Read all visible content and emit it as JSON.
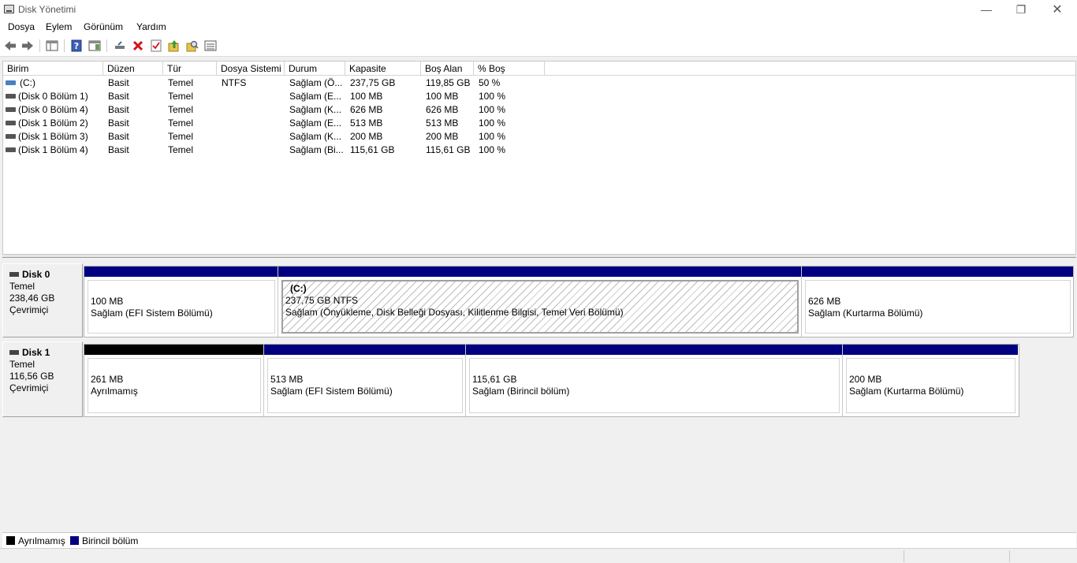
{
  "window": {
    "title": "Disk Yönetimi"
  },
  "menu": [
    "Dosya",
    "Eylem",
    "Görünüm",
    "Yardım"
  ],
  "toolbar": [
    "back-icon",
    "forward-icon",
    "console-tree-icon",
    "help-icon",
    "show-hide-icon",
    "connect-icon",
    "delete-icon",
    "properties-icon",
    "up-arrow-icon",
    "search-icon",
    "list-view-icon"
  ],
  "list": {
    "columns": [
      "Birim",
      "Düzen",
      "Tür",
      "Dosya Sistemi",
      "Durum",
      "Kapasite",
      "Boş Alan",
      "% Boş"
    ],
    "rows": [
      [
        "(C:)",
        "Basit",
        "Temel",
        "NTFS",
        "Sağlam (Ö...",
        "237,75 GB",
        "119,85 GB",
        "50 %"
      ],
      [
        "(Disk 0 Bölüm 1)",
        "Basit",
        "Temel",
        "",
        "Sağlam (E...",
        "100 MB",
        "100 MB",
        "100 %"
      ],
      [
        "(Disk 0 Bölüm 4)",
        "Basit",
        "Temel",
        "",
        "Sağlam (K...",
        "626 MB",
        "626 MB",
        "100 %"
      ],
      [
        "(Disk 1 Bölüm 2)",
        "Basit",
        "Temel",
        "",
        "Sağlam (E...",
        "513 MB",
        "513 MB",
        "100 %"
      ],
      [
        "(Disk 1 Bölüm 3)",
        "Basit",
        "Temel",
        "",
        "Sağlam (K...",
        "200 MB",
        "200 MB",
        "100 %"
      ],
      [
        "(Disk 1 Bölüm 4)",
        "Basit",
        "Temel",
        "",
        "Sağlam (Bi...",
        "115,61 GB",
        "115,61 GB",
        "100 %"
      ]
    ]
  },
  "disks": [
    {
      "name": "Disk 0",
      "type": "Temel",
      "size": "238,46 GB",
      "status": "Çevrimiçi",
      "partitions": [
        {
          "size": "100 MB",
          "status": "Sağlam (EFI Sistem Bölümü)"
        },
        {
          "label": "(C:)",
          "size": "237,75 GB NTFS",
          "status": "Sağlam (Önyükleme, Disk Belleği Dosyası, Kilitlenme Bilgisi, Temel Veri Bölümü)"
        },
        {
          "size": "626 MB",
          "status": "Sağlam (Kurtarma Bölümü)"
        }
      ]
    },
    {
      "name": "Disk 1",
      "type": "Temel",
      "size": "116,56 GB",
      "status": "Çevrimiçi",
      "partitions": [
        {
          "size": "261 MB",
          "status": "Ayrılmamış"
        },
        {
          "size": "513 MB",
          "status": "Sağlam (EFI Sistem Bölümü)"
        },
        {
          "size": "115,61 GB",
          "status": "Sağlam (Birincil bölüm)"
        },
        {
          "size": "200 MB",
          "status": "Sağlam (Kurtarma Bölümü)"
        }
      ]
    }
  ],
  "legend": [
    {
      "label": "Ayrılmamış",
      "color": "#000000"
    },
    {
      "label": "Birincil bölüm",
      "color": "#000080"
    }
  ]
}
